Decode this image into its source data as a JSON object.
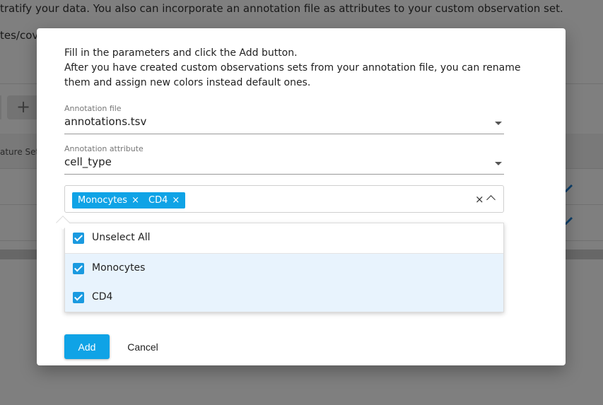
{
  "background": {
    "text_line1": "tratify your data. You also can incorporate an annotation file as attributes to your custom observation set.",
    "text_line2": "tes/cova",
    "plus_button": "+",
    "table_header_text": "ature Set"
  },
  "dialog": {
    "intro_line1": "Fill in the parameters and click the Add button.",
    "intro_line2": "After you have created custom observations sets from your annotation file, you can rename them and assign new colors instead default ones.",
    "annotation_file": {
      "label": "Annotation file",
      "value": "annotations.tsv"
    },
    "annotation_attribute": {
      "label": "Annotation attribute",
      "value": "cell_type"
    },
    "selected_chips": [
      {
        "label": "Monocytes"
      },
      {
        "label": "CD4"
      }
    ],
    "chip_remove_glyph": "×",
    "clear_glyph": "×",
    "dropdown_options": [
      {
        "label": "Unselect All",
        "checked": true
      },
      {
        "label": "Monocytes",
        "checked": true
      },
      {
        "label": "CD4",
        "checked": true
      }
    ],
    "add_button": "Add",
    "cancel_button": "Cancel"
  },
  "colors": {
    "accent": "#0fa3e6",
    "checkbox": "#1a9ae0",
    "selected_row": "#e8f3fd",
    "edit_icon": "#1a7fd4"
  }
}
